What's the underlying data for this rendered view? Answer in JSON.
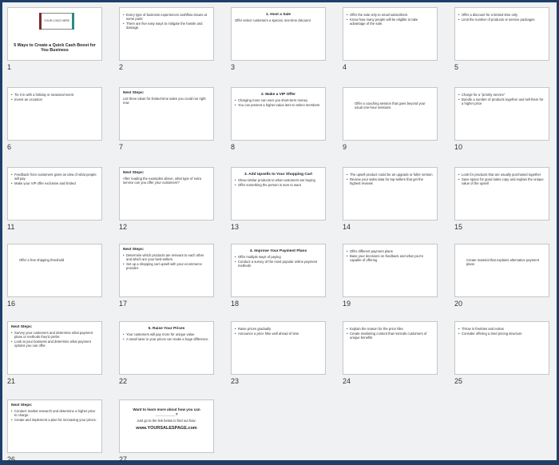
{
  "cover": {
    "logo_text": "YOUR LOGO HERE",
    "title": "5 Ways to Create a Quick Cash Boost for You Business"
  },
  "slides": [
    {
      "num": "1"
    },
    {
      "num": "2",
      "bullets": [
        "Every type of business experiences cashflow issues at some point",
        "There are five easy ways to mitigate the hassle and damage."
      ]
    },
    {
      "num": "3",
      "title": "1. Host a Sale",
      "text": [
        "Offer select customers a special, one-time discount"
      ]
    },
    {
      "num": "4",
      "bullets": [
        "Offer the sale only to email subscribers",
        "Know how many people will be eligible to take advantage of the sale."
      ]
    },
    {
      "num": "5",
      "bullets": [
        "Offer a discount for a limited time only",
        "Limit the number of products or service packages"
      ]
    },
    {
      "num": "6",
      "bullets": [
        "Tie it in with a holiday or seasonal event",
        "Invent an occasion"
      ]
    },
    {
      "num": "7",
      "title": "Next Steps:",
      "text": [
        "List three ideas for limited-time sales you could run right now"
      ]
    },
    {
      "num": "8",
      "title": "2. Make a VIP Offer",
      "bullets": [
        "Charging more can earn you short-term money",
        "You can present a higher-value item to select members"
      ]
    },
    {
      "num": "9",
      "text": [
        "Offer a coaching session that goes beyond your usual one-hour sessions"
      ]
    },
    {
      "num": "10",
      "bullets": [
        "Charge for a \"priority service\"",
        "Bundle a number of products together and sell them for a higher price"
      ]
    },
    {
      "num": "11",
      "bullets": [
        "Feedback from customers gives an idea of what people will pay",
        "Make your VIP offer exclusive and limited"
      ]
    },
    {
      "num": "12",
      "title": "Next Steps:",
      "text": [
        "After reading the examples above, what type of extra service can you offer your customers?"
      ]
    },
    {
      "num": "13",
      "title": "3. Add Upsells to Your Shopping Cart",
      "bullets": [
        "Show similar products to what customers are buying",
        "Offer something the person is sure to want"
      ]
    },
    {
      "num": "14",
      "bullets": [
        "The upsell product could be an upgrade or fuller version",
        "Review your sales data for top-sellers that get the highest reviews"
      ]
    },
    {
      "num": "15",
      "bullets": [
        "Look for products that are usually purchased together",
        "Save space for good sales copy and explain the unique value of the upsell"
      ]
    },
    {
      "num": "16",
      "text": [
        "Offer a free shipping threshold"
      ]
    },
    {
      "num": "17",
      "title": "Next Steps:",
      "bullets": [
        "Determine which products are relevant to each other and which are your best-sellers.",
        "Set up a shopping cart upsell with your ecommerce provider."
      ]
    },
    {
      "num": "18",
      "title": "4. Improve Your Payment Plans",
      "bullets": [
        "Offer multiple ways of paying",
        "Conduct a survey of the most popular online payment methods"
      ]
    },
    {
      "num": "19",
      "bullets": [
        "Offer different payment plans",
        "Base your decisions on feedback and what you're capable of offering"
      ]
    },
    {
      "num": "20",
      "text": [
        "Create material that explains alternative payment plans"
      ]
    },
    {
      "num": "21",
      "title": "Next Steps:",
      "bullets": [
        "Survey your customers and determine what payment plans or methods they'd prefer.",
        "Look at your business and determine what payment options you can offer."
      ]
    },
    {
      "num": "22",
      "title": "5. Raise Your Prices",
      "bullets": [
        "Your customers will pay more for unique value",
        "A small raise in your prices can make a huge difference"
      ]
    },
    {
      "num": "23",
      "bullets": [
        "Raise prices gradually",
        "Announce a price hike well ahead of time"
      ]
    },
    {
      "num": "24",
      "bullets": [
        "Explain the reason for the price hike",
        "Create marketing content that reminds customers of unique benefits"
      ]
    },
    {
      "num": "25",
      "bullets": [
        "Throw in freebies and extras",
        "Consider offering a tired pricing structure"
      ]
    },
    {
      "num": "26",
      "title": "Next Steps:",
      "bullets": [
        "Conduct market research and determine a higher price to charge.",
        "Create and implement a plan for increasing your prices."
      ]
    },
    {
      "num": "27",
      "ask": "Want to learn more about how you can __________?",
      "ask_sub": "Just go to the link below to find out how:",
      "url": "www.YOURSALESPAGE.com"
    }
  ]
}
